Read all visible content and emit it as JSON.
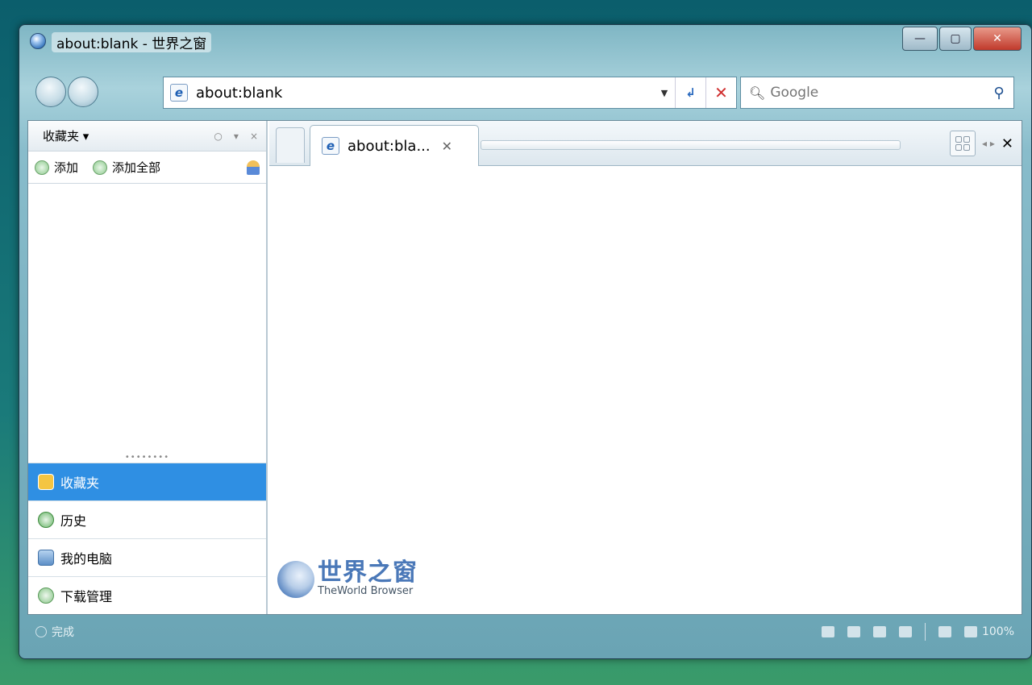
{
  "window": {
    "title": "about:blank - 世界之窗",
    "minimize": "—",
    "maximize": "▢",
    "close": "✕"
  },
  "toolbar": {
    "address": "about:blank",
    "address_dropdown": "▼",
    "go": "↲",
    "stop": "✕",
    "search_placeholder": "Google",
    "search_go": "⚲"
  },
  "sidebar": {
    "title": "收藏夹 ▾",
    "header_controls": [
      "○",
      "▾",
      "×"
    ],
    "tools": [
      {
        "label": "添加"
      },
      {
        "label": "添加全部"
      }
    ],
    "grip": "••••••••",
    "nav": [
      {
        "label": "收藏夹",
        "active": true
      },
      {
        "label": "历史"
      },
      {
        "label": "我的电脑"
      },
      {
        "label": "下载管理"
      }
    ]
  },
  "tabs": [
    {
      "title": "about:bla...",
      "close": "✕"
    }
  ],
  "tab_tools": {
    "arrows": "◂ ▸",
    "close": "✕"
  },
  "logo": {
    "cn": "世界之窗",
    "en": "TheWorld Browser"
  },
  "status": {
    "text": "完成",
    "zoom": "100%"
  },
  "colors": {
    "active_nav": "#2f8fe3",
    "stop_red": "#d03030",
    "accent_blue": "#2c6bbf"
  },
  "icons": [
    "app-globe-icon",
    "back-icon",
    "forward-icon",
    "ie-page-icon",
    "search-icon",
    "add-favorite-icon",
    "user-icon",
    "history-icon",
    "computer-icon",
    "download-icon",
    "tiles-icon"
  ]
}
